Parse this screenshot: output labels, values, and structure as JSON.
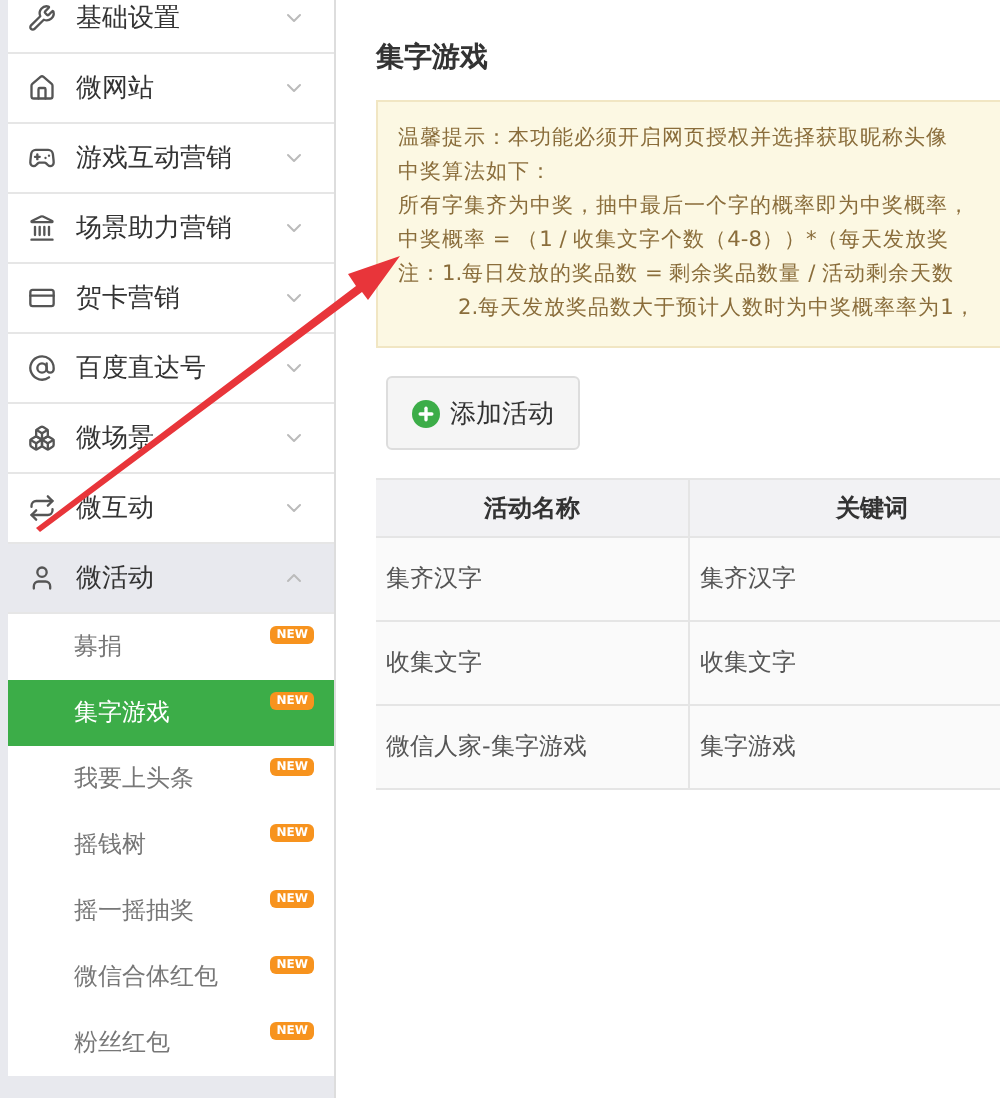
{
  "sidebar": {
    "items": [
      {
        "label": "基础设置",
        "expanded": false
      },
      {
        "label": "微网站",
        "expanded": false
      },
      {
        "label": "游戏互动营销",
        "expanded": false
      },
      {
        "label": "场景助力营销",
        "expanded": false
      },
      {
        "label": "贺卡营销",
        "expanded": false
      },
      {
        "label": "百度直达号",
        "expanded": false
      },
      {
        "label": "微场景",
        "expanded": false
      },
      {
        "label": "微互动",
        "expanded": false
      },
      {
        "label": "微活动",
        "expanded": true,
        "children": [
          {
            "label": "募捐",
            "badge": "NEW",
            "selected": false
          },
          {
            "label": "集字游戏",
            "badge": "NEW",
            "selected": true
          },
          {
            "label": "我要上头条",
            "badge": "NEW",
            "selected": false
          },
          {
            "label": "摇钱树",
            "badge": "NEW",
            "selected": false
          },
          {
            "label": "摇一摇抽奖",
            "badge": "NEW",
            "selected": false
          },
          {
            "label": "微信合体红包",
            "badge": "NEW",
            "selected": false
          },
          {
            "label": "粉丝红包",
            "badge": "NEW",
            "selected": false
          }
        ]
      }
    ]
  },
  "page": {
    "title": "集字游戏",
    "notice": [
      "温馨提示：本功能必须开启网页授权并选择获取昵称头像",
      "中奖算法如下：",
      "所有字集齐为中奖，抽中最后一个字的概率即为中奖概率，",
      "中奖概率 = （1 / 收集文字个数（4-8））*（每天发放奖",
      "注：1.每日发放的奖品数 = 剩余奖品数量 / 活动剩余天数",
      "2.每天发放奖品数大于预计人数时为中奖概率率为1，"
    ],
    "add_button": "添加活动",
    "table": {
      "columns": [
        "活动名称",
        "关键词"
      ],
      "rows": [
        [
          "集齐汉字",
          "集齐汉字"
        ],
        [
          "收集文字",
          "收集文字"
        ],
        [
          "微信人家-集字游戏",
          "集字游戏"
        ]
      ]
    }
  }
}
